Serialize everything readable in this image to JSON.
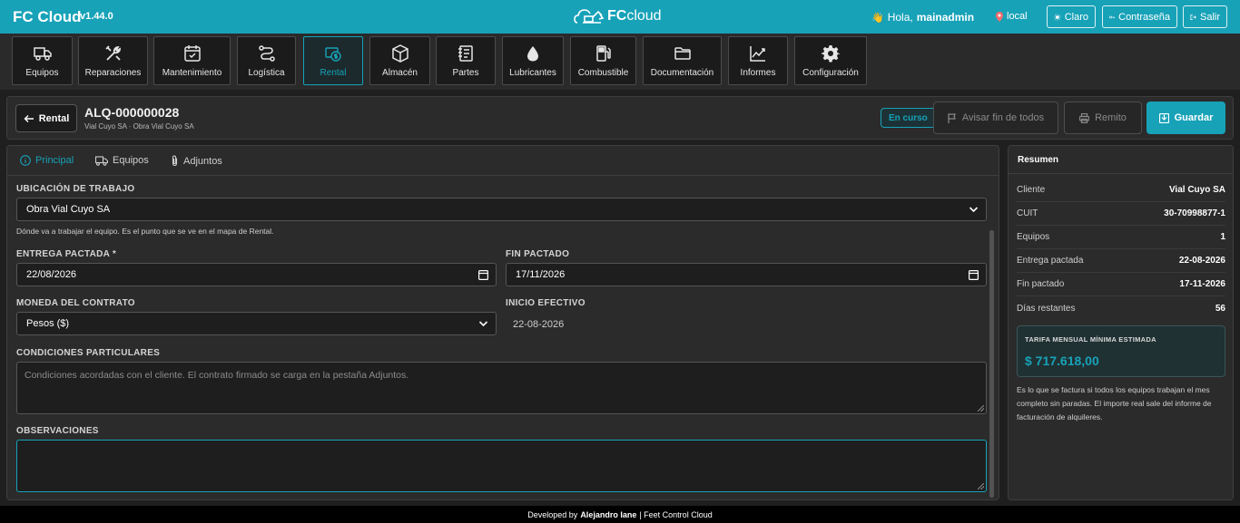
{
  "app": {
    "name": "FC Cloud",
    "version": "v1.44.0",
    "logo_text_bold": "FC",
    "logo_text_light": "cloud",
    "greeting_prefix": "Hola,",
    "username": "mainadmin",
    "location": "local",
    "buttons": {
      "theme": "Claro",
      "password": "Contraseña",
      "logout": "Salir"
    }
  },
  "nav": [
    {
      "label": "Equipos",
      "icon": "truck-icon"
    },
    {
      "label": "Reparaciones",
      "icon": "tools-icon"
    },
    {
      "label": "Mantenimiento",
      "icon": "calendar-check-icon"
    },
    {
      "label": "Logística",
      "icon": "route-icon"
    },
    {
      "label": "Rental",
      "icon": "rental-icon",
      "active": true
    },
    {
      "label": "Almacén",
      "icon": "box-icon"
    },
    {
      "label": "Partes",
      "icon": "notebook-icon"
    },
    {
      "label": "Lubricantes",
      "icon": "drop-icon"
    },
    {
      "label": "Combustible",
      "icon": "fuel-icon"
    },
    {
      "label": "Documentación",
      "icon": "folder-icon"
    },
    {
      "label": "Informes",
      "icon": "chart-line-icon"
    },
    {
      "label": "Configuración",
      "icon": "gear-icon"
    }
  ],
  "record": {
    "back_label": "Rental",
    "code": "ALQ-000000028",
    "subtitle": "Vial Cuyo SA · Obra Vial Cuyo SA",
    "status": "En curso",
    "actions": {
      "notify_end": "Avisar fin de todos",
      "remit": "Remito",
      "save": "Guardar"
    }
  },
  "tabs": [
    {
      "label": "Principal",
      "icon": "info-icon",
      "active": true
    },
    {
      "label": "Equipos",
      "icon": "truck-icon"
    },
    {
      "label": "Adjuntos",
      "icon": "paperclip-icon"
    }
  ],
  "form": {
    "ubicacion": {
      "label": "UBICACIÓN DE TRABAJO",
      "value": "Obra Vial Cuyo SA",
      "help": "Dónde va a trabajar el equipo. Es el punto que se ve en el mapa de Rental."
    },
    "entrega": {
      "label": "ENTREGA PACTADA *",
      "value": "22/08/2026"
    },
    "fin": {
      "label": "FIN PACTADO",
      "value": "17/11/2026"
    },
    "moneda": {
      "label": "MONEDA DEL CONTRATO",
      "value": "Pesos ($)"
    },
    "inicio": {
      "label": "INICIO EFECTIVO",
      "value": "22-08-2026"
    },
    "condiciones": {
      "label": "CONDICIONES PARTICULARES",
      "placeholder": "Condiciones acordadas con el cliente. El contrato firmado se carga en la pestaña Adjuntos."
    },
    "observaciones": {
      "label": "OBSERVACIONES",
      "value": ""
    }
  },
  "summary": {
    "title": "Resumen",
    "rows": [
      {
        "key": "Cliente",
        "value": "Vial Cuyo SA"
      },
      {
        "key": "CUIT",
        "value": "30-70998877-1"
      },
      {
        "key": "Equipos",
        "value": "1"
      },
      {
        "key": "Entrega pactada",
        "value": "22-08-2026"
      },
      {
        "key": "Fin pactado",
        "value": "17-11-2026"
      },
      {
        "key": "Días restantes",
        "value": "56"
      }
    ],
    "tarifa_label": "TARIFA MENSUAL MÍNIMA ESTIMADA",
    "tarifa_value": "$ 717.618,00",
    "note": "Es lo que se factura si todos los equipos trabajan el mes completo sin paradas. El importe real sale del informe de facturación de alquileres."
  },
  "footer": {
    "prefix": "Developed by",
    "author": "Alejandro Iane",
    "suffix": "| Feet Control Cloud"
  },
  "colors": {
    "accent": "#17a2b8",
    "background": "#1f1f1f",
    "panel": "#2b2b2b"
  }
}
